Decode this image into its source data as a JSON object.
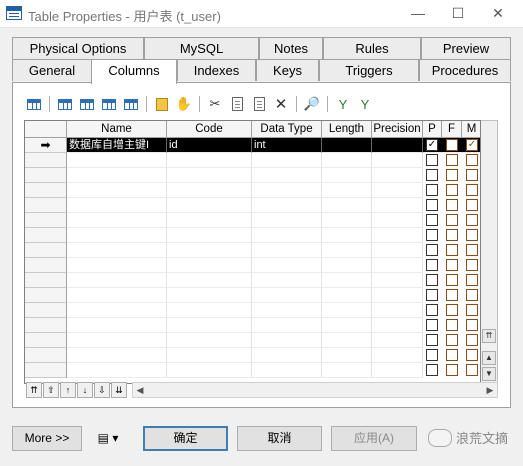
{
  "window": {
    "title": "Table Properties - 用户表 (t_user)"
  },
  "tabs_row1": [
    "Physical Options",
    "MySQL",
    "Notes",
    "Rules",
    "Preview"
  ],
  "tabs_row2": [
    "General",
    "Columns",
    "Indexes",
    "Keys",
    "Triggers",
    "Procedures"
  ],
  "active_tab": "Columns",
  "toolbar_icons": [
    "properties-icon",
    "insert-row-icon",
    "add-row-icon",
    "add-rows-icon",
    "edit-icon",
    "new-icon",
    "find-column-icon",
    "cut-icon",
    "copy-icon",
    "paste-icon",
    "delete-icon",
    "find-icon",
    "filter-icon",
    "filter-clear-icon"
  ],
  "grid": {
    "columns": [
      "Name",
      "Code",
      "Data Type",
      "Length",
      "Precision",
      "P",
      "F",
      "M"
    ],
    "rows": [
      {
        "marker": "➡",
        "name": "数据库自增主键I",
        "code": "id",
        "data_type": "int",
        "length": "",
        "precision": "",
        "p": true,
        "f": false,
        "m": true
      }
    ],
    "empty_rows": 15
  },
  "nav_buttons": [
    "⇈",
    "⇧",
    "↑",
    "↓",
    "⇩",
    "⇊"
  ],
  "buttons": {
    "more": "More >>",
    "ok": "确定",
    "cancel": "取消",
    "apply": "应用(A)"
  },
  "watermark": "浪荒文摘"
}
